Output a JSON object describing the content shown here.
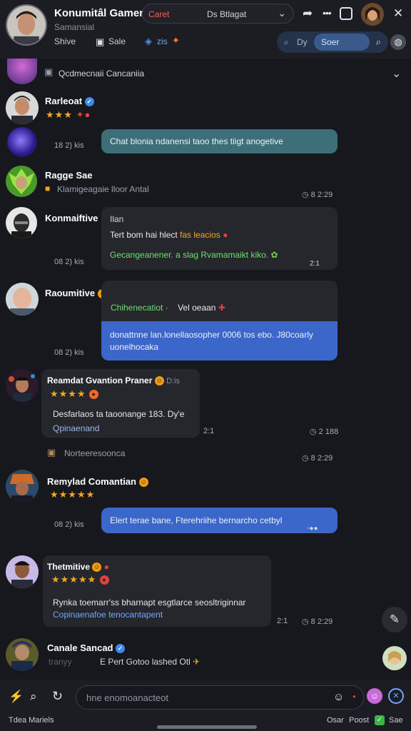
{
  "header": {
    "title": "Konumitâl Gamer",
    "subtitle": "Samansial",
    "link_share": "Shive",
    "link_save": "Sale",
    "link_tags": "zis",
    "pill_red": "Caret",
    "pill_dropdown": "Ds Btlagat",
    "search_left": "Dy",
    "search_button": "Soer"
  },
  "pinned": {
    "text": "Qcdmecnaii Cancaniia"
  },
  "messages": [
    {
      "name": "Rarleoat",
      "stars": "★★★",
      "time": "18 2) kis",
      "bubble": "Chat blonia ndanensi taoo thes tiigt anogetive",
      "bubble_time": ""
    },
    {
      "name": "Ragge Sae",
      "sub": "Klamigeagaie lloor Antal",
      "time": "8 2:29"
    },
    {
      "name": "Konmaiftive",
      "line1": "Ilan",
      "line2_plain": "Tert bom hai hlect ",
      "line2_orange": "fas leacios",
      "line3": "Gecangeanener. a slag Rvamamaikt kiko.",
      "time": "08 2) kis",
      "bubble_time": "2:1"
    },
    {
      "name": "Raoumitive",
      "sub_green": "Chihenecatiot",
      "sub_white": "Vel oeaan",
      "bubble": "donattnne lan.lonellaosopher 0006 tos ebo. J80coarly uonelhocaka",
      "time": "08 2) kis"
    },
    {
      "name": "Reamdat Gvantion Praner",
      "extra": "D:is",
      "stars": "★★★★",
      "line1": "Desfarlaos ta taoonange 183. Dy'e",
      "line2": "Qpinaenand",
      "time_left": "2:1",
      "time": "2 188"
    },
    {
      "sub": "Norteeresoonca",
      "time": "8 2:29"
    },
    {
      "name": "Remylad Comantian",
      "stars": "★★★★★",
      "bubble": "Elert terae bane, Fterehriihe bernarcho cetbyl",
      "time": "08 2) kis"
    },
    {
      "name": "Thetmitive",
      "stars": "★★★★★",
      "line1": "Rynka toemarr'ss bharnapt esgtlarce seosltriginnar",
      "line2": "Copinaenafoe tenocantapent",
      "time_left": "2:1",
      "time": "8 2:29"
    },
    {
      "name": "Canale Sancad",
      "sub": "E Pert Gotoo lashed  Otl",
      "sub_faded": "tranyy"
    }
  ],
  "composer": {
    "placeholder": "hne enomoanacteot",
    "bottom_left": "Tdea  Mariels",
    "bottom_right_a": "Osar",
    "bottom_right_b": "Poost",
    "bottom_right_c": "Sae"
  }
}
